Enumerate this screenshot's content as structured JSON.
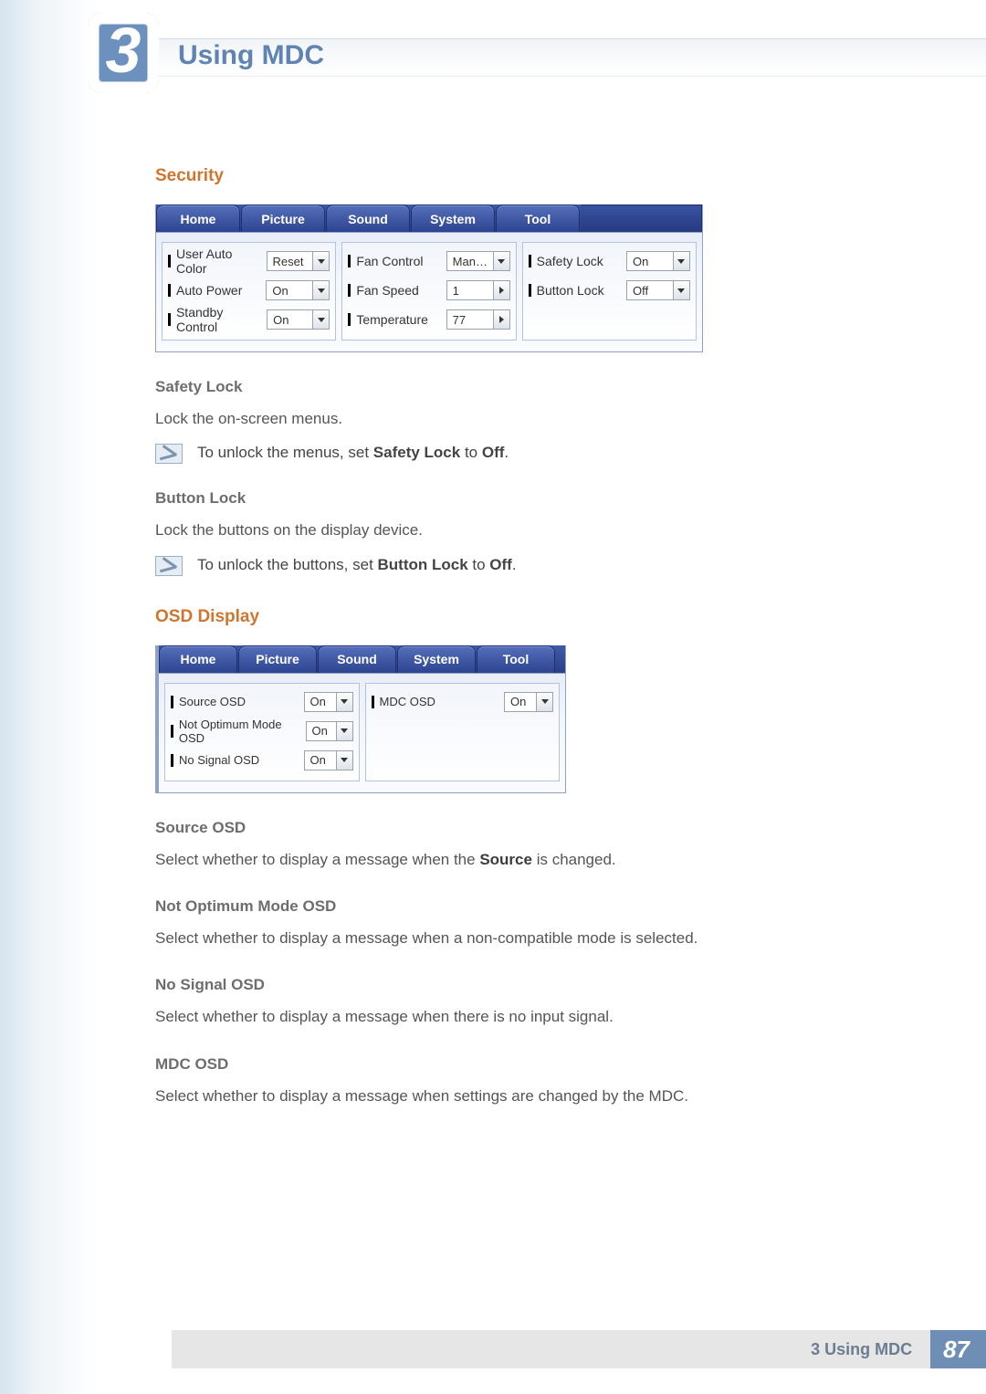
{
  "chapter": {
    "number": "3",
    "title": "Using MDC"
  },
  "security": {
    "heading": "Security",
    "tabs": [
      "Home",
      "Picture",
      "Sound",
      "System",
      "Tool"
    ],
    "col1": [
      {
        "label": "User Auto Color",
        "control": "dd",
        "value": "Reset"
      },
      {
        "label": "Auto Power",
        "control": "dd",
        "value": "On"
      },
      {
        "label": "Standby Control",
        "control": "dd",
        "value": "On"
      }
    ],
    "col2": [
      {
        "label": "Fan Control",
        "control": "dd",
        "value": "Man…"
      },
      {
        "label": "Fan Speed",
        "control": "spin",
        "value": "1"
      },
      {
        "label": "Temperature",
        "control": "spin",
        "value": "77"
      }
    ],
    "col3": [
      {
        "label": "Safety Lock",
        "control": "dd",
        "value": "On"
      },
      {
        "label": "Button Lock",
        "control": "dd",
        "value": "Off"
      }
    ],
    "safety_lock": {
      "heading": "Safety Lock",
      "desc": "Lock the on-screen menus.",
      "note_pre": "To unlock the menus, set ",
      "note_bold": "Safety Lock",
      "note_mid": " to ",
      "note_bold2": "Off",
      "note_post": "."
    },
    "button_lock": {
      "heading": "Button Lock",
      "desc": "Lock the buttons on the display device.",
      "note_pre": "To unlock the buttons, set ",
      "note_bold": "Button Lock",
      "note_mid": " to ",
      "note_bold2": "Off",
      "note_post": "."
    }
  },
  "osd": {
    "heading": "OSD Display",
    "tabs": [
      "Home",
      "Picture",
      "Sound",
      "System",
      "Tool"
    ],
    "col1": [
      {
        "label": "Source OSD",
        "value": "On"
      },
      {
        "label": "Not Optimum Mode OSD",
        "value": "On"
      },
      {
        "label": "No Signal OSD",
        "value": "On"
      }
    ],
    "col2": [
      {
        "label": "MDC OSD",
        "value": "On"
      }
    ],
    "source_osd": {
      "heading": "Source OSD",
      "desc_pre": "Select whether to display a message when the ",
      "desc_bold": "Source",
      "desc_post": " is changed."
    },
    "not_optimum": {
      "heading": "Not Optimum Mode OSD",
      "desc": "Select whether to display a message when a non-compatible mode is selected."
    },
    "no_signal": {
      "heading": "No Signal OSD",
      "desc": "Select whether to display a message when there is no input signal."
    },
    "mdc_osd": {
      "heading": "MDC OSD",
      "desc": "Select whether to display a message when settings are changed by the MDC."
    }
  },
  "footer": {
    "section": "3 Using MDC",
    "page": "87"
  }
}
